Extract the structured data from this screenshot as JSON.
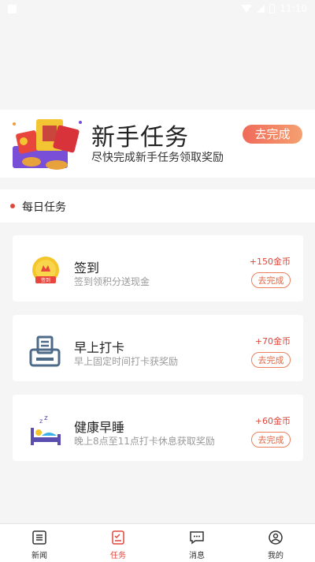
{
  "status_bar": {
    "time": "11:10"
  },
  "banner": {
    "title": "新手任务",
    "subtitle": "尽快完成新手任务领取奖励",
    "button_label": "去完成"
  },
  "daily": {
    "section_title": "每日任务",
    "tasks": [
      {
        "title": "签到",
        "desc": "签到领积分送现金",
        "reward": "+150金币",
        "button": "去完成",
        "icon": "sign-in-badge-icon"
      },
      {
        "title": "早上打卡",
        "desc": "早上固定时间打卡获奖励",
        "reward": "+70金币",
        "button": "去完成",
        "icon": "punch-clock-icon"
      },
      {
        "title": "健康早睡",
        "desc": "晚上8点至11点打卡休息获取奖励",
        "reward": "+60金币",
        "button": "去完成",
        "icon": "sleep-bed-icon"
      }
    ]
  },
  "tabbar": {
    "items": [
      {
        "label": "新闻",
        "icon": "news-icon",
        "active": false
      },
      {
        "label": "任务",
        "icon": "task-icon",
        "active": true
      },
      {
        "label": "消息",
        "icon": "message-icon",
        "active": false
      },
      {
        "label": "我的",
        "icon": "profile-icon",
        "active": false
      }
    ]
  },
  "colors": {
    "accent": "#e0473c",
    "button_gradient_start": "#ef6a5a",
    "button_gradient_end": "#f5a070"
  }
}
